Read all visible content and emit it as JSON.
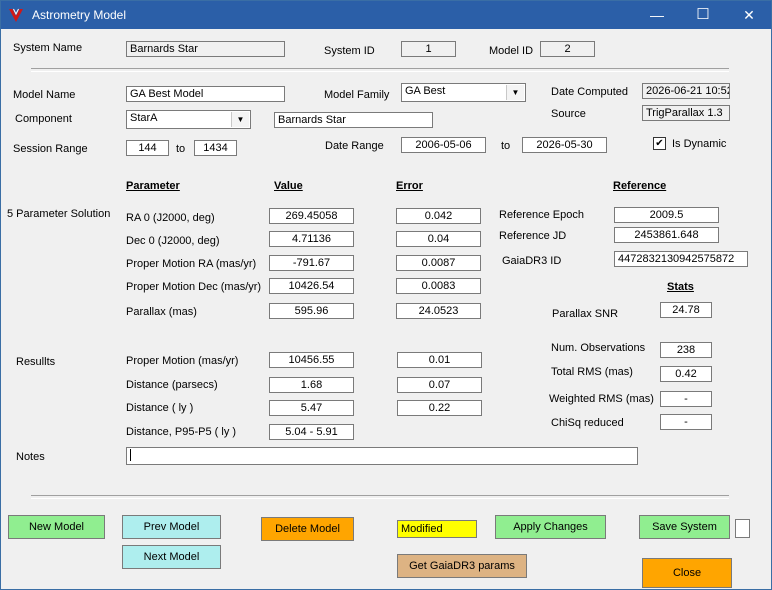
{
  "window": {
    "title": "Astrometry Model",
    "minimize_glyph": "—",
    "maximize_glyph": "☐",
    "close_glyph": "✕"
  },
  "header": {
    "system_name_label": "System Name",
    "system_name_value": "Barnards Star",
    "system_id_label": "System ID",
    "system_id_value": "1",
    "model_id_label": "Model ID",
    "model_id_value": "2"
  },
  "model": {
    "model_name_label": "Model Name",
    "model_name_value": "GA Best Model",
    "model_family_label": "Model Family",
    "model_family_value": "GA Best",
    "date_computed_label": "Date Computed",
    "date_computed_value": "2026-06-21 10:52",
    "component_label": "Component",
    "component_value": "StarA",
    "component_name_value": "Barnards Star",
    "source_label": "Source",
    "source_value": "TrigParallax 1.3",
    "session_range_label": "Session Range",
    "session_from": "144",
    "session_to_label": "to",
    "session_to": "1434",
    "date_range_label": "Date Range",
    "date_from": "2006-05-06",
    "date_to_label": "to",
    "date_to": "2026-05-30",
    "is_dynamic_label": "Is Dynamic",
    "is_dynamic_checked": true
  },
  "columns": {
    "parameter": "Parameter",
    "value": "Value",
    "error": "Error",
    "reference": "Reference",
    "stats": "Stats"
  },
  "solution": {
    "section_label": "5 Parameter Solution",
    "rows": [
      {
        "label": "RA 0 (J2000, deg)",
        "value": "269.45058",
        "error": "0.042"
      },
      {
        "label": "Dec 0 (J2000, deg)",
        "value": "4.71136",
        "error": "0.04"
      },
      {
        "label": "Proper Motion RA (mas/yr)",
        "value": "-791.67",
        "error": "0.0087"
      },
      {
        "label": "Proper Motion Dec (mas/yr)",
        "value": "10426.54",
        "error": "0.0083"
      },
      {
        "label": "Parallax (mas)",
        "value": "595.96",
        "error": "24.0523"
      }
    ]
  },
  "reference": {
    "epoch_label": "Reference Epoch",
    "epoch_value": "2009.5",
    "jd_label": "Reference JD",
    "jd_value": "2453861.648",
    "gaia_label": "GaiaDR3 ID",
    "gaia_value": "4472832130942575872"
  },
  "results": {
    "section_label": "Resullts",
    "rows": [
      {
        "label": "Proper Motion (mas/yr)",
        "value": "10456.55",
        "error": "0.01"
      },
      {
        "label": "Distance (parsecs)",
        "value": "1.68",
        "error": "0.07"
      },
      {
        "label": "Distance ( ly )",
        "value": "5.47",
        "error": "0.22"
      },
      {
        "label": "Distance, P95-P5 ( ly )",
        "value": "5.04 - 5.91",
        "error": ""
      }
    ]
  },
  "stats": {
    "parallax_snr_label": "Parallax SNR",
    "parallax_snr_value": "24.78",
    "num_obs_label": "Num. Observations",
    "num_obs_value": "238",
    "total_rms_label": "Total RMS (mas)",
    "total_rms_value": "0.42",
    "weighted_rms_label": "Weighted RMS (mas)",
    "weighted_rms_value": "-",
    "chisq_label": "ChiSq reduced",
    "chisq_value": "-"
  },
  "notes": {
    "label": "Notes",
    "value": ""
  },
  "buttons": {
    "new_model": "New Model",
    "prev_model": "Prev Model",
    "next_model": "Next Model",
    "delete_model": "Delete Model",
    "status": "Modified",
    "apply_changes": "Apply Changes",
    "get_gaia": "Get GaiaDR3 params",
    "save_system": "Save System",
    "close": "Close"
  },
  "colors": {
    "titlebar": "#2b5fa8",
    "green_button": "#90ee90",
    "cyan_button": "#aeeeee",
    "orange_button": "#ffa500",
    "tan_button": "#ddb383",
    "status_yellow": "#ffff00",
    "app_icon_red": "#d01818"
  },
  "icons": {
    "app": "v-logo-icon",
    "checkbox": "checkmark-icon"
  }
}
